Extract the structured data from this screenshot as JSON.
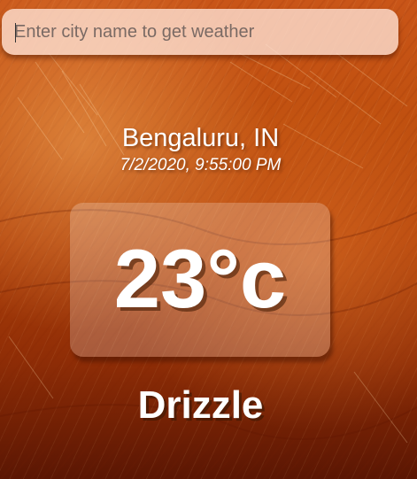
{
  "search": {
    "placeholder": "Enter city name to get weather",
    "value": ""
  },
  "location": {
    "name": "Bengaluru, IN",
    "datetime": "7/2/2020, 9:55:00 PM"
  },
  "weather": {
    "temperature": "23°c",
    "condition": "Drizzle"
  },
  "colors": {
    "background_top": "#c95518",
    "background_bottom": "#5a1603",
    "text": "#ffffff"
  }
}
